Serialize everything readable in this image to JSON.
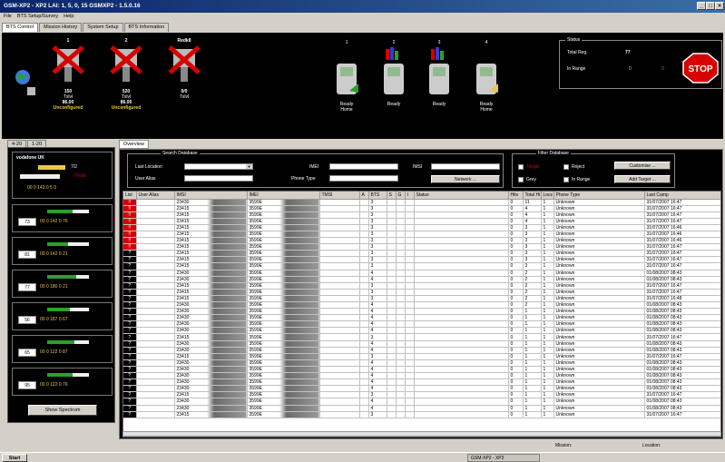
{
  "window": {
    "title": "GSM-XP2 - XP2     LAI: 1, 5, 0, 15  GSMXP2 - 1.5.0.16"
  },
  "menu": [
    "File",
    "BTS Setup/Survey",
    "Help"
  ],
  "tabs": [
    "BTS Control",
    "Mission History",
    "System Setup",
    "BTS Information"
  ],
  "bts": [
    {
      "num": "1",
      "value": "150",
      "value_label": "Txlvl",
      "freq": "86.00",
      "state": "Unconfigured"
    },
    {
      "num": "2",
      "value": "520",
      "value_label": "Txlvl",
      "freq": "86.00",
      "state": "Unconfigured"
    },
    {
      "num": "Redk8",
      "value": "0/0",
      "value_label": "Txlvl",
      "freq": "",
      "state": ""
    }
  ],
  "mobiles": [
    {
      "num": "1",
      "status": "Ready",
      "sub": "Home"
    },
    {
      "num": "2",
      "status": "Ready",
      "sub": ""
    },
    {
      "num": "3",
      "status": "Ready",
      "sub": ""
    },
    {
      "num": "4",
      "status": "Ready",
      "sub": "Home"
    }
  ],
  "status": {
    "title": "Status",
    "total_reg_label": "Total Reg.",
    "total_reg": "77",
    "in_range_label": "In Range",
    "in_range_a": "0",
    "in_range_b": "0",
    "stop_label": "STOP"
  },
  "left_tabs": [
    "4-20",
    "1-20"
  ],
  "left": {
    "network": "vodafone UK",
    "net_value": "7/2",
    "net_db": "-78 db",
    "net_bar": "00 0 143 0 5 0",
    "cells": [
      {
        "id": "73",
        "bar": "00 0 142 0 76",
        "level": 0.6
      },
      {
        "id": "81",
        "bar": "00 0 142 0 21",
        "level": 0.5
      },
      {
        "id": "77",
        "bar": "00 0 180 0 21",
        "level": 0.7
      },
      {
        "id": "56",
        "bar": "00 0 187 0 67",
        "level": 0.55
      },
      {
        "id": "65",
        "bar": "00 0 122 0 87",
        "level": 0.65
      },
      {
        "id": "95",
        "bar": "00 0 122 0 76",
        "level": 0.6
      }
    ],
    "show_spectrum": "Show Spectrum"
  },
  "overview_tab": "Overview",
  "search": {
    "title": "Search Database",
    "last_location": "Last Location",
    "user_alias": "User Alias",
    "imei": "IMEI",
    "imsi": "IMSI",
    "phone_type": "Phone Type",
    "network_btn": "Network ..."
  },
  "filter": {
    "title": "Filter Database",
    "target": "Target",
    "reject": "Reject",
    "grey": "Grey",
    "in_range": "In Range",
    "customise": "Customise ...",
    "add_target": "Add Target ..."
  },
  "columns": [
    "List",
    "User Alias",
    "IMSI",
    "IMEI",
    "TMSI",
    "A",
    "BTS",
    "S",
    "G",
    "I",
    "Status",
    "Hits",
    "Total Hi",
    "Locs",
    "Phone Type",
    "Last Camp"
  ],
  "rows": [
    [
      "!!",
      "",
      "23430",
      "3599E",
      "",
      "",
      "3",
      "",
      "",
      "",
      "",
      "0",
      "11",
      "1",
      "Unknown",
      "31/07/2007 16:47"
    ],
    [
      "!!",
      "",
      "23415",
      "3599E",
      "",
      "",
      "3",
      "",
      "",
      "",
      "",
      "0",
      "4",
      "1",
      "Unknown",
      "31/07/2007 16:47"
    ],
    [
      "!!",
      "",
      "23415",
      "3599E",
      "",
      "",
      "3",
      "",
      "",
      "",
      "",
      "0",
      "4",
      "1",
      "Unknown",
      "31/07/2007 16:47"
    ],
    [
      "!!",
      "",
      "23415",
      "3599E",
      "",
      "",
      "3",
      "",
      "",
      "",
      "",
      "0",
      "4",
      "1",
      "Unknown",
      "31/07/2007 16:47"
    ],
    [
      "!!",
      "",
      "23415",
      "3599E",
      "",
      "",
      "3",
      "",
      "",
      "",
      "",
      "0",
      "3",
      "1",
      "Unknown",
      "31/07/2007 16:46"
    ],
    [
      "!!",
      "",
      "23415",
      "3599E",
      "",
      "",
      "3",
      "",
      "",
      "",
      "",
      "0",
      "3",
      "1",
      "Unknown",
      "31/07/2007 16:46"
    ],
    [
      "!!",
      "",
      "23415",
      "3599E",
      "",
      "",
      "3",
      "",
      "",
      "",
      "",
      "0",
      "3",
      "1",
      "Unknown",
      "31/07/2007 16:46"
    ],
    [
      "!!",
      "",
      "23415",
      "3599E",
      "",
      "",
      "3",
      "",
      "",
      "",
      "",
      "0",
      "3",
      "1",
      "Unknown",
      "31/07/2007 16:47"
    ],
    [
      "?",
      "",
      "23415",
      "3599E",
      "",
      "",
      "3",
      "",
      "",
      "",
      "",
      "0",
      "3",
      "1",
      "Unknown",
      "31/07/2007 16:47"
    ],
    [
      "?",
      "",
      "23415",
      "3599E",
      "",
      "",
      "3",
      "",
      "",
      "",
      "",
      "0",
      "3",
      "1",
      "Unknown",
      "31/07/2007 16:47"
    ],
    [
      "?",
      "",
      "23415",
      "3599E",
      "",
      "",
      "3",
      "",
      "",
      "",
      "",
      "0",
      "3",
      "1",
      "Unknown",
      "31/07/2007 16:47"
    ],
    [
      "?",
      "",
      "23430",
      "3599E",
      "",
      "",
      "4",
      "",
      "",
      "",
      "",
      "0",
      "2",
      "1",
      "Unknown",
      "01/08/2007 08:43"
    ],
    [
      "?",
      "",
      "23430",
      "3599E",
      "",
      "",
      "4",
      "",
      "",
      "",
      "",
      "0",
      "2",
      "1",
      "Unknown",
      "01/08/2007 08:43"
    ],
    [
      "?",
      "",
      "23415",
      "3599E",
      "",
      "",
      "3",
      "",
      "",
      "",
      "",
      "0",
      "2",
      "1",
      "Unknown",
      "31/07/2007 16:47"
    ],
    [
      "?",
      "",
      "23415",
      "3599E",
      "",
      "",
      "3",
      "",
      "",
      "",
      "",
      "0",
      "2",
      "1",
      "Unknown",
      "31/07/2007 16:47"
    ],
    [
      "?",
      "",
      "23415",
      "3599E",
      "",
      "",
      "3",
      "",
      "",
      "",
      "",
      "0",
      "2",
      "1",
      "Unknown",
      "31/07/2007 16:48"
    ],
    [
      "?",
      "",
      "23430",
      "3599E",
      "",
      "",
      "4",
      "",
      "",
      "",
      "",
      "0",
      "2",
      "1",
      "Unknown",
      "01/08/2007 08:43"
    ],
    [
      "?",
      "",
      "23430",
      "3599E",
      "",
      "",
      "4",
      "",
      "",
      "",
      "",
      "0",
      "1",
      "1",
      "Unknown",
      "01/08/2007 08:43"
    ],
    [
      "?",
      "",
      "23430",
      "3599E",
      "",
      "",
      "4",
      "",
      "",
      "",
      "",
      "0",
      "1",
      "1",
      "Unknown",
      "01/08/2007 08:43"
    ],
    [
      "?",
      "",
      "23430",
      "3599E",
      "",
      "",
      "4",
      "",
      "",
      "",
      "",
      "0",
      "1",
      "1",
      "Unknown",
      "01/08/2007 08:43"
    ],
    [
      "?",
      "",
      "23430",
      "3599E",
      "",
      "",
      "4",
      "",
      "",
      "",
      "",
      "0",
      "1",
      "1",
      "Unknown",
      "01/08/2007 08:43"
    ],
    [
      "?",
      "",
      "23415",
      "3599E",
      "",
      "",
      "3",
      "",
      "",
      "",
      "",
      "0",
      "1",
      "1",
      "Unknown",
      "31/07/2007 16:47"
    ],
    [
      "?",
      "",
      "23430",
      "3599E",
      "",
      "",
      "4",
      "",
      "",
      "",
      "",
      "0",
      "1",
      "1",
      "Unknown",
      "01/08/2007 08:43"
    ],
    [
      "?",
      "",
      "23430",
      "3599E",
      "",
      "",
      "4",
      "",
      "",
      "",
      "",
      "0",
      "1",
      "1",
      "Unknown",
      "01/08/2007 08:43"
    ],
    [
      "?",
      "",
      "23415",
      "3599E",
      "",
      "",
      "3",
      "",
      "",
      "",
      "",
      "0",
      "1",
      "1",
      "Unknown",
      "31/07/2007 16:47"
    ],
    [
      "?",
      "",
      "23430",
      "3599E",
      "",
      "",
      "4",
      "",
      "",
      "",
      "",
      "0",
      "1",
      "1",
      "Unknown",
      "01/08/2007 08:43"
    ],
    [
      "?",
      "",
      "23430",
      "3599E",
      "",
      "",
      "4",
      "",
      "",
      "",
      "",
      "0",
      "1",
      "1",
      "Unknown",
      "01/08/2007 08:43"
    ],
    [
      "?",
      "",
      "23430",
      "3599E",
      "",
      "",
      "4",
      "",
      "",
      "",
      "",
      "0",
      "1",
      "1",
      "Unknown",
      "01/08/2007 08:43"
    ],
    [
      "?",
      "",
      "23430",
      "3599E",
      "",
      "",
      "4",
      "",
      "",
      "",
      "",
      "0",
      "1",
      "1",
      "Unknown",
      "01/08/2007 08:43"
    ],
    [
      "?",
      "",
      "23430",
      "3599E",
      "",
      "",
      "4",
      "",
      "",
      "",
      "",
      "0",
      "1",
      "1",
      "Unknown",
      "01/08/2007 08:43"
    ],
    [
      "?",
      "",
      "23415",
      "3599E",
      "",
      "",
      "3",
      "",
      "",
      "",
      "",
      "0",
      "1",
      "1",
      "Unknown",
      "31/07/2007 16:47"
    ],
    [
      "?",
      "",
      "23430",
      "3599E",
      "",
      "",
      "4",
      "",
      "",
      "",
      "",
      "0",
      "1",
      "1",
      "Unknown",
      "01/08/2007 08:43"
    ],
    [
      "?",
      "",
      "23430",
      "3599E",
      "",
      "",
      "4",
      "",
      "",
      "",
      "",
      "0",
      "1",
      "1",
      "Unknown",
      "01/08/2007 08:43"
    ],
    [
      "?",
      "",
      "23415",
      "3599E",
      "",
      "",
      "3",
      "",
      "",
      "",
      "",
      "0",
      "1",
      "1",
      "Unknown",
      "31/07/2007 16:47"
    ]
  ],
  "statusbar": {
    "mission": "Mission:",
    "location": "Location:"
  },
  "taskbar": {
    "start": "Start",
    "item": "GSM-XP2 - XP2"
  },
  "colors": {
    "red": "#d60000",
    "yellow": "#e8c64a",
    "green": "#2ca02c"
  }
}
